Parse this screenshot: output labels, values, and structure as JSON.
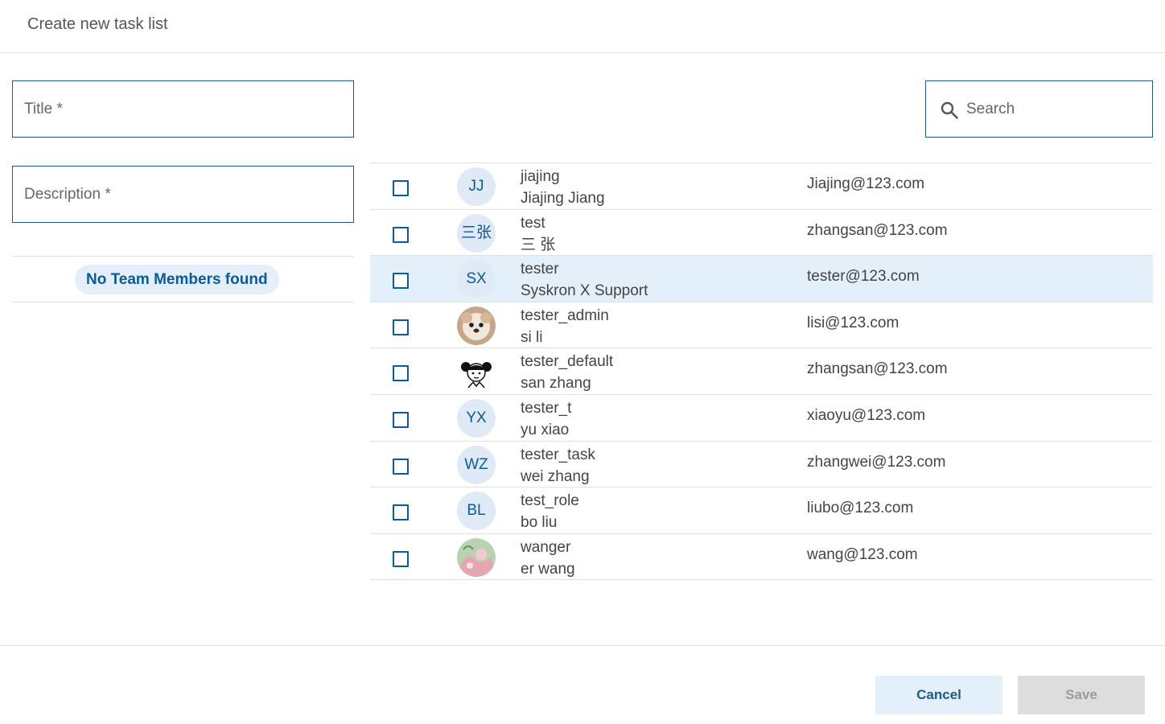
{
  "header": {
    "title": "Create new task list"
  },
  "form": {
    "title_placeholder": "Title *",
    "description_placeholder": "Description *"
  },
  "team_members": {
    "empty_label": "No Team Members found"
  },
  "search": {
    "placeholder": "Search"
  },
  "users": [
    {
      "username": "jiajing",
      "fullname": "Jiajing Jiang",
      "email": "Jiajing@123.com",
      "initials": "JJ",
      "avatar": "initials",
      "selected": false
    },
    {
      "username": "test",
      "fullname": "三 张",
      "email": "zhangsan@123.com",
      "initials": "三张",
      "avatar": "initials",
      "selected": false
    },
    {
      "username": "tester",
      "fullname": "Syskron X Support",
      "email": "tester@123.com",
      "initials": "SX",
      "avatar": "initials",
      "selected": true
    },
    {
      "username": "tester_admin",
      "fullname": "si li",
      "email": "lisi@123.com",
      "initials": "",
      "avatar": "photo-puppy",
      "selected": false
    },
    {
      "username": "tester_default",
      "fullname": "san zhang",
      "email": "zhangsan@123.com",
      "initials": "",
      "avatar": "cartoon-girl",
      "selected": false
    },
    {
      "username": "tester_t",
      "fullname": "yu xiao",
      "email": "xiaoyu@123.com",
      "initials": "YX",
      "avatar": "initials",
      "selected": false
    },
    {
      "username": "tester_task",
      "fullname": "wei zhang",
      "email": "zhangwei@123.com",
      "initials": "WZ",
      "avatar": "initials",
      "selected": false
    },
    {
      "username": "test_role",
      "fullname": "bo liu",
      "email": "liubo@123.com",
      "initials": "BL",
      "avatar": "initials",
      "selected": false
    },
    {
      "username": "wanger",
      "fullname": "er wang",
      "email": "wang@123.com",
      "initials": "",
      "avatar": "photo-illustration",
      "selected": false
    }
  ],
  "buttons": {
    "cancel": "Cancel",
    "save": "Save"
  },
  "colors": {
    "primary": "#0b5a9c",
    "selected_row": "#e3f0f9",
    "field_border": "#1f5a87",
    "disabled": "#dddddd"
  }
}
